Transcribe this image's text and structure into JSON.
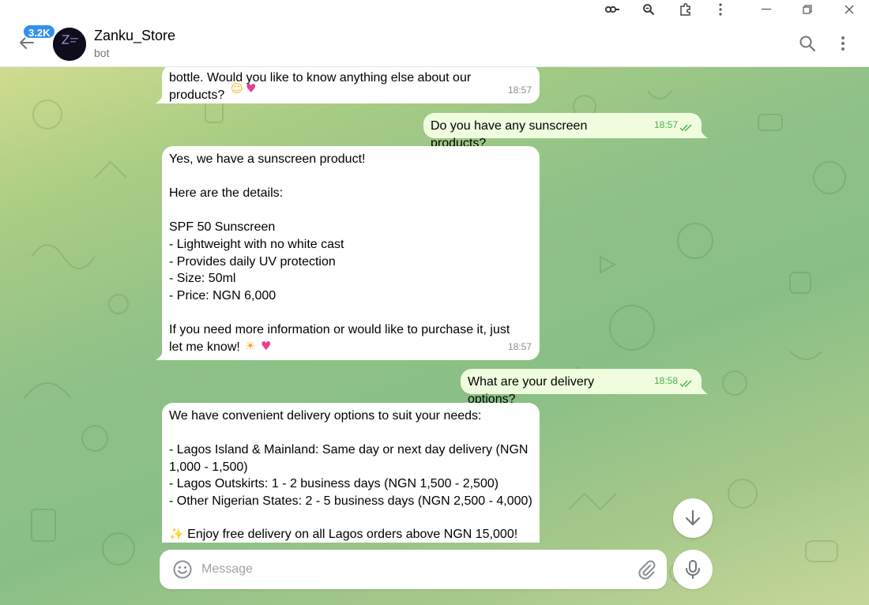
{
  "chat": {
    "name": "Zanku_Store",
    "status": "bot",
    "unread_badge": "3.2K",
    "avatar_text": "ZANKU"
  },
  "messages": [
    {
      "dir": "in",
      "text": "bottle. Would you like to know anything else about our\nproducts? ",
      "emojis": [
        "smiling-face-emoji",
        "heart-emoji"
      ],
      "time": "18:57"
    },
    {
      "dir": "out",
      "text": "Do you have any sunscreen products?",
      "time": "18:57",
      "read": true
    },
    {
      "dir": "in",
      "text": "Yes, we have a sunscreen product!\n\nHere are the details:\n\nSPF 50 Sunscreen\n- Lightweight with no white cast\n- Provides daily UV protection\n- Size: 50ml\n- Price: NGN 6,000\n\nIf you need more information or would like to purchase it, just\nlet me know! ",
      "emojis": [
        "sun-emoji",
        "heart-emoji"
      ],
      "time": "18:57"
    },
    {
      "dir": "out",
      "text": "What are your delivery options?",
      "time": "18:58",
      "read": true
    },
    {
      "dir": "in",
      "text": "We have convenient delivery options to suit your needs:\n\n- Lagos Island & Mainland: Same day or next day delivery (NGN\n1,000 - 1,500)\n- Lagos Outskirts: 1 - 2 business days (NGN 1,500 - 2,500)\n- Other Nigerian States: 2 - 5 business days (NGN 2,500 - 4,000)\n\n",
      "sparkle_line": "Enjoy free delivery on all Lagos orders above NGN 15,000!",
      "time": ""
    }
  ],
  "composer": {
    "placeholder": "Message"
  },
  "icons": {
    "window": [
      "key-icon",
      "zoom-icon",
      "extension-icon",
      "menu-dots-icon",
      "minimize-icon",
      "restore-icon",
      "close-icon"
    ],
    "header": [
      "back-arrow-icon",
      "search-icon",
      "more-icon"
    ],
    "composer": [
      "emoji-icon",
      "paperclip-icon",
      "microphone-icon",
      "arrow-down-icon"
    ]
  },
  "colors": {
    "accent": "#3390ec",
    "outgoing_bubble": "#effdde",
    "read_check": "#4fae4e"
  }
}
